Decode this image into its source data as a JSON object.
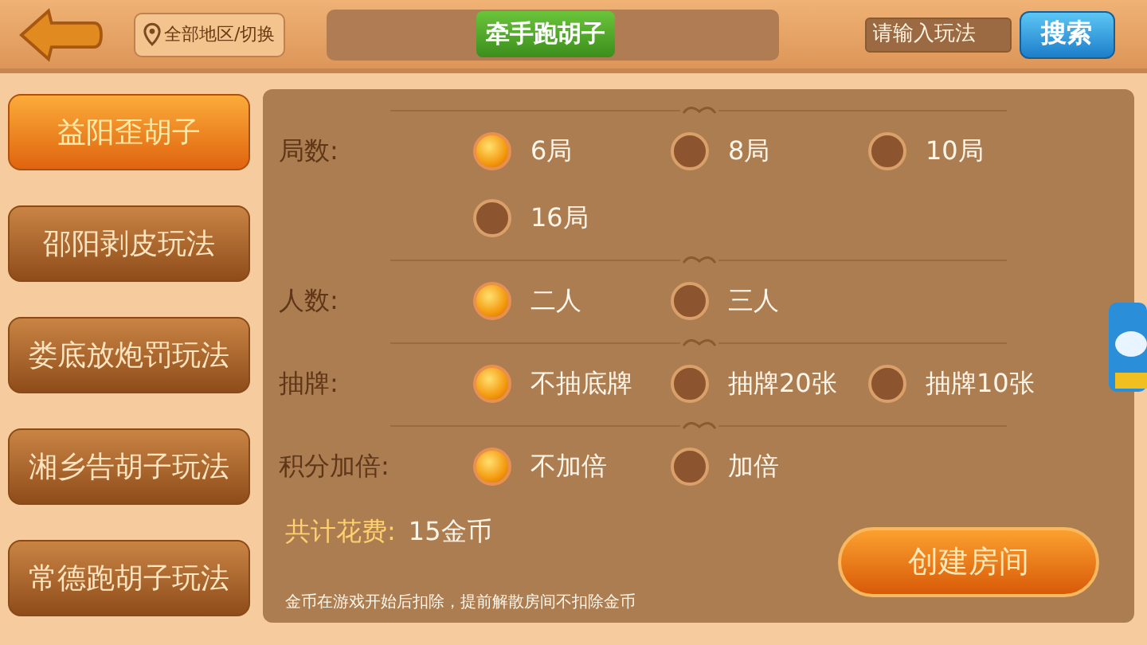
{
  "top_bar": {
    "region_button": "全部地区/切换",
    "title": "牵手跑胡子",
    "search": {
      "placeholder": "请输入玩法"
    },
    "search_button": "搜索"
  },
  "sidebar": {
    "items": [
      {
        "label": "益阳歪胡子",
        "selected": true
      },
      {
        "label": "邵阳剥皮玩法",
        "selected": false
      },
      {
        "label": "娄底放炮罚玩法",
        "selected": false
      },
      {
        "label": "湘乡告胡子玩法",
        "selected": false
      },
      {
        "label": "常德跑胡子玩法",
        "selected": false
      }
    ]
  },
  "settings": [
    {
      "label": "局数:",
      "options": [
        {
          "label": "6局",
          "selected": true
        },
        {
          "label": "8局",
          "selected": false
        },
        {
          "label": "10局",
          "selected": false
        },
        {
          "label": "16局",
          "selected": false
        }
      ]
    },
    {
      "label": "人数:",
      "options": [
        {
          "label": "二人",
          "selected": true
        },
        {
          "label": "三人",
          "selected": false
        }
      ]
    },
    {
      "label": "抽牌:",
      "options": [
        {
          "label": "不抽底牌",
          "selected": true
        },
        {
          "label": "抽牌20张",
          "selected": false
        },
        {
          "label": "抽牌10张",
          "selected": false
        }
      ]
    },
    {
      "label": "积分加倍:",
      "options": [
        {
          "label": "不加倍",
          "selected": true
        },
        {
          "label": "加倍",
          "selected": false
        }
      ]
    }
  ],
  "footer": {
    "cost_label": "共计花费:",
    "cost_value": "15金币",
    "create_button": "创建房间",
    "note": "金币在游戏开始后扣除，提前解散房间不扣除金币"
  }
}
